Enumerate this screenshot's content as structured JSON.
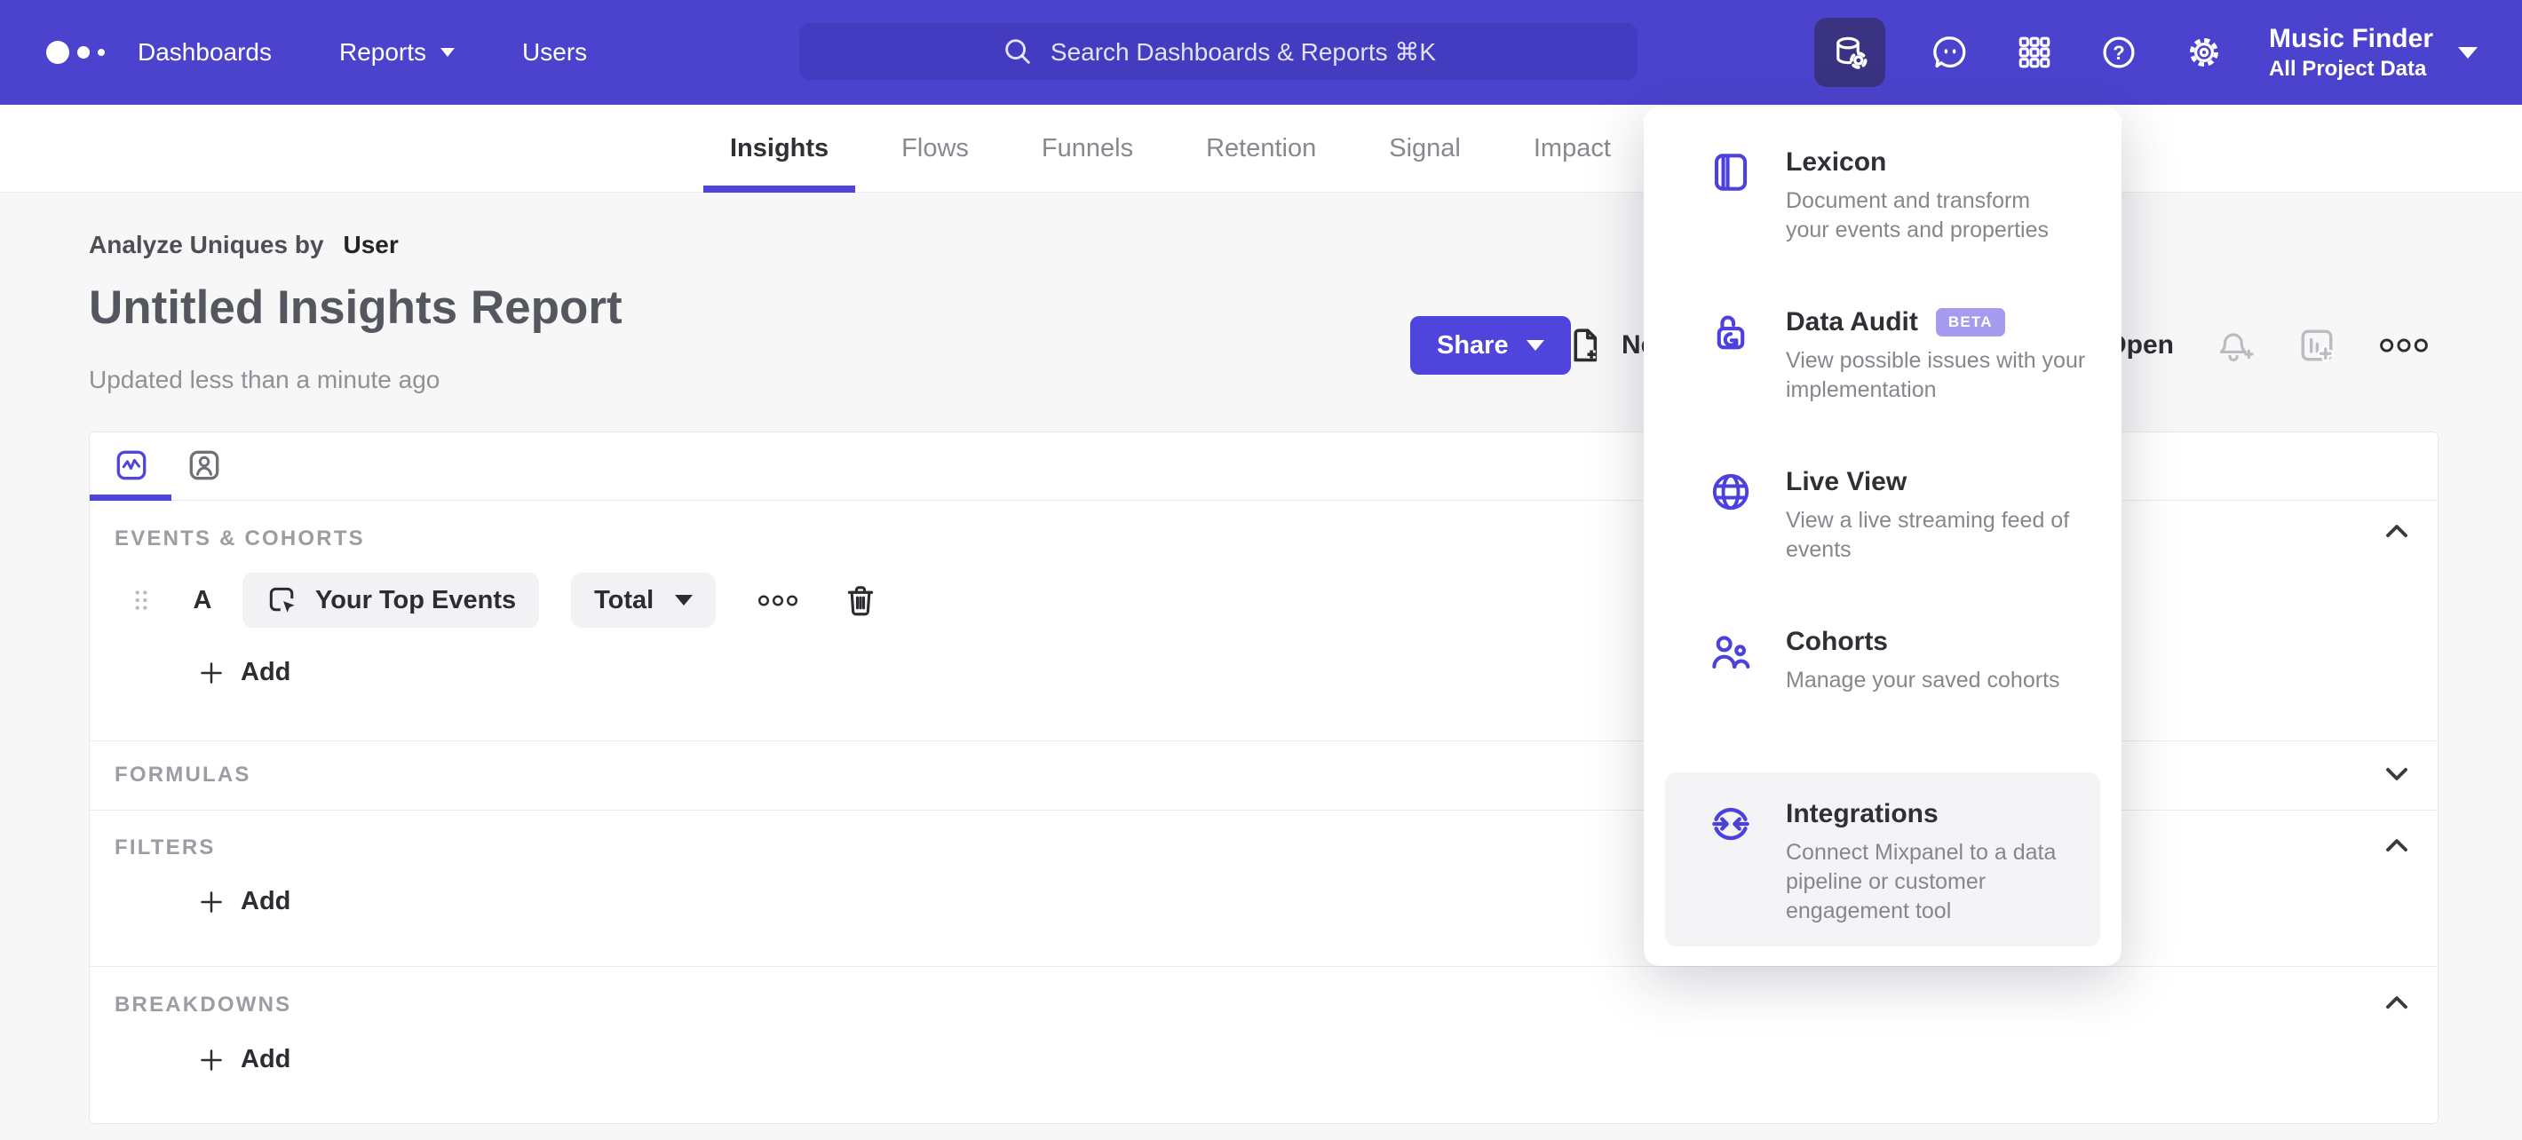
{
  "nav": {
    "items": [
      "Dashboards",
      "Reports",
      "Users"
    ],
    "search_placeholder": "Search Dashboards & Reports ⌘K",
    "project_name": "Music Finder",
    "project_scope": "All Project Data"
  },
  "report_tabs": {
    "items": [
      "Insights",
      "Flows",
      "Funnels",
      "Retention",
      "Signal",
      "Impact"
    ],
    "active": "Insights"
  },
  "header": {
    "analyze_label": "Analyze Uniques by",
    "analyze_value": "User",
    "title": "Untitled Insights Report",
    "updated": "Updated less than a minute ago",
    "share_label": "Share",
    "new_label": "New",
    "open_label": "Open"
  },
  "builder": {
    "events": {
      "label": "EVENTS & COHORTS",
      "row_letter": "A",
      "event_name": "Your Top Events",
      "metric": "Total",
      "add_label": "Add"
    },
    "formulas": {
      "label": "FORMULAS"
    },
    "filters": {
      "label": "FILTERS",
      "add_label": "Add"
    },
    "breakdowns": {
      "label": "BREAKDOWNS",
      "add_label": "Add"
    }
  },
  "data_menu": {
    "items": [
      {
        "icon": "lexicon-book-icon",
        "title": "Lexicon",
        "desc": "Document and transform\nyour events and properties"
      },
      {
        "icon": "data-audit-lock-icon",
        "title": "Data Audit",
        "badge": "BETA",
        "desc": "View possible issues with your\nimplementation"
      },
      {
        "icon": "live-view-globe-icon",
        "title": "Live View",
        "desc": "View a live streaming feed of\nevents"
      },
      {
        "icon": "cohorts-users-icon",
        "title": "Cohorts",
        "desc": "Manage your saved cohorts"
      },
      {
        "icon": "integrations-sync-icon",
        "title": "Integrations",
        "desc": "Connect Mixpanel to a data\npipeline or customer\nengagement tool"
      }
    ]
  },
  "colors": {
    "nav_bg": "#4b43ce",
    "accent": "#4f44db",
    "active_tile_bg": "#3a3381",
    "beta_badge_bg": "#a59cef",
    "page_bg": "#f7f7f8"
  }
}
